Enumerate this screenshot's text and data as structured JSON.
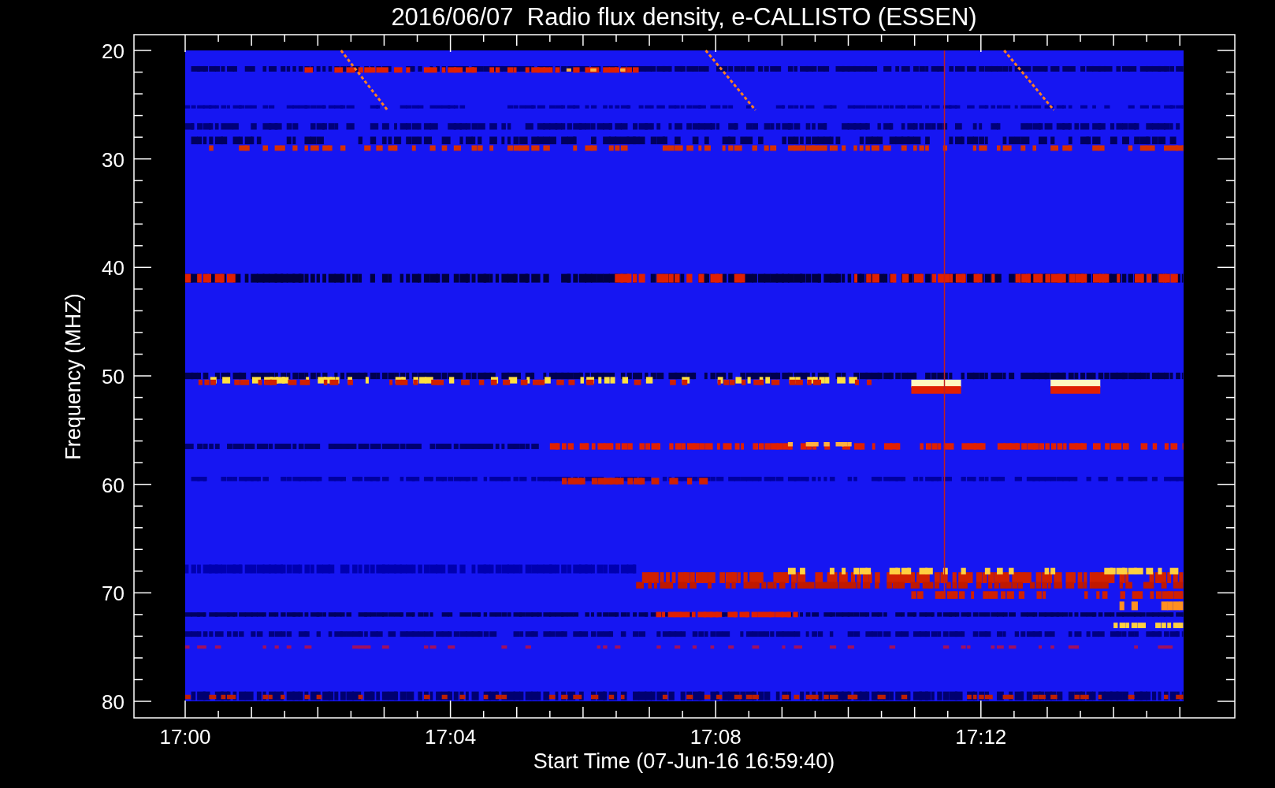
{
  "title": "2016/06/07  Radio flux density, e-CALLISTO (ESSEN)",
  "ylabel": "Frequency (MHZ)",
  "xlabel": "Start Time (07-Jun-16 16:59:40)",
  "yticks": [
    "20",
    "30",
    "40",
    "50",
    "60",
    "70",
    "80"
  ],
  "xticks": [
    "17:00",
    "17:04",
    "17:08",
    "17:12"
  ]
}
